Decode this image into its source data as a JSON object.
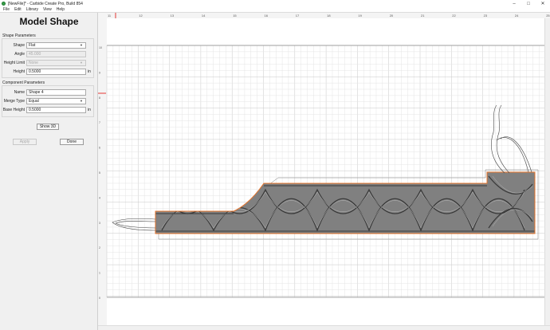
{
  "window": {
    "title": "[NewFile]* - Carbide Create Pro, Build 854",
    "minimize": "–",
    "maximize": "□",
    "close": "✕"
  },
  "menu": [
    "File",
    "Edit",
    "Library",
    "View",
    "Help"
  ],
  "panel": {
    "title": "Model Shape",
    "shape_params": {
      "label": "Shape Parameters",
      "shape": {
        "label": "Shape",
        "value": "Flat"
      },
      "angle": {
        "label": "Angle",
        "value": "45.000"
      },
      "height_limit": {
        "label": "Height Limit",
        "value": "None"
      },
      "height": {
        "label": "Height",
        "value": "0.5000",
        "unit": "in"
      }
    },
    "component_params": {
      "label": "Component Parameters",
      "name": {
        "label": "Name",
        "value": "Shape 4"
      },
      "merge_type": {
        "label": "Merge Type",
        "value": "Equal"
      },
      "base_height": {
        "label": "Base Height",
        "value": "0.5000",
        "unit": "in"
      }
    },
    "show3d": "Show 3D",
    "apply": "Apply",
    "done": "Done"
  },
  "ruler": {
    "top_ticks": [
      "11",
      "12",
      "13",
      "14",
      "15",
      "16",
      "17",
      "18",
      "19",
      "20",
      "21",
      "22",
      "23",
      "24",
      "25"
    ],
    "left_ticks": [
      "10",
      "9",
      "8",
      "7",
      "6",
      "5",
      "4",
      "3",
      "2",
      "1",
      "0"
    ]
  },
  "colors": {
    "shape_fill": "#808080",
    "shape_outline": "#e8742a",
    "grid_major": "#c8c8c8",
    "grid_minor": "#e4e4e4",
    "ruler_marker": "#e53935"
  }
}
